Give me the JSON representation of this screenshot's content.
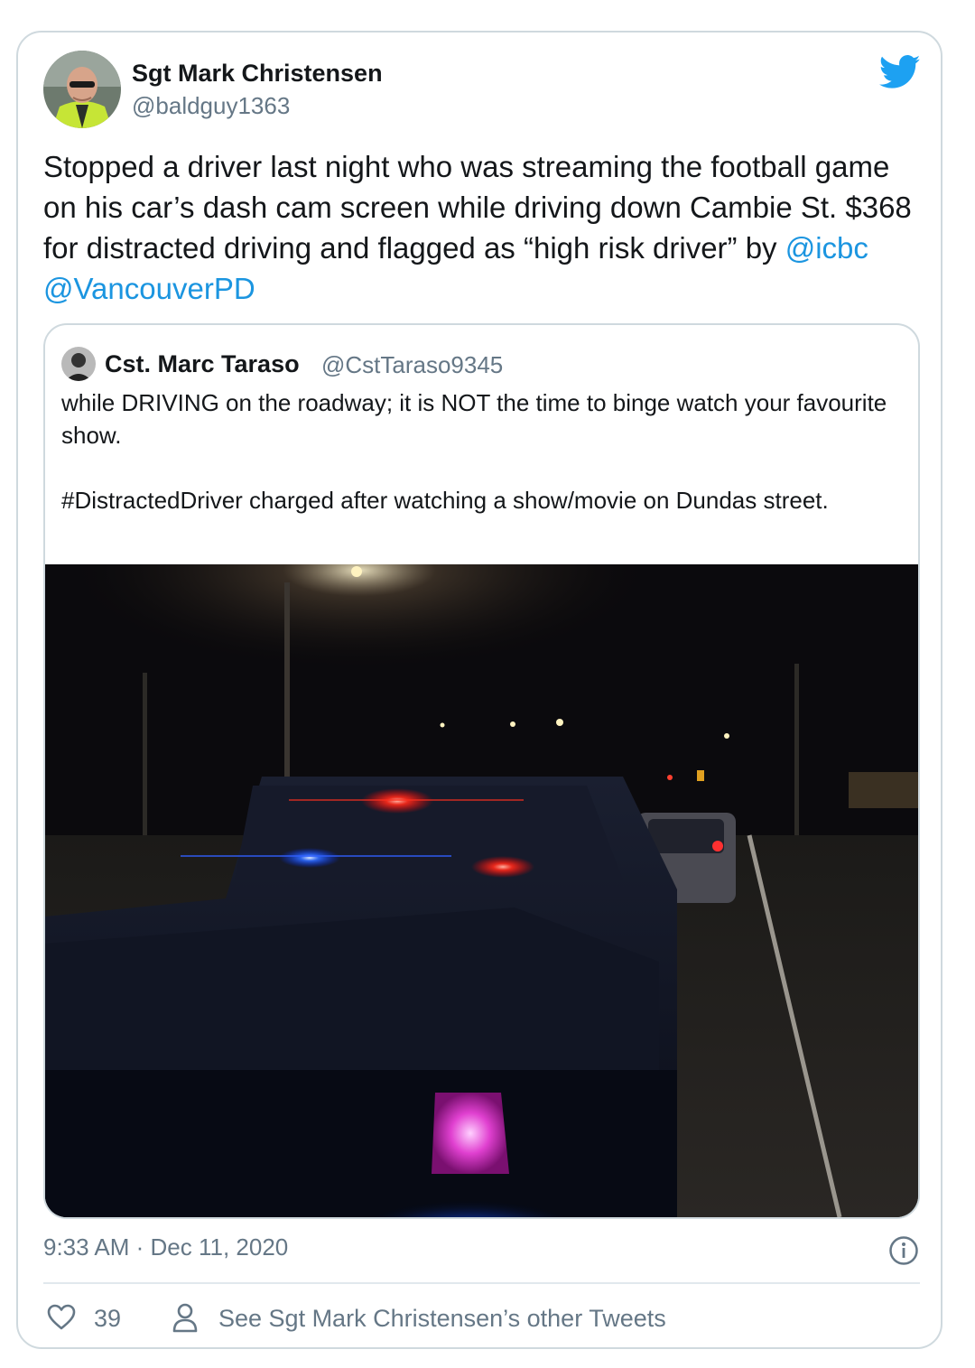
{
  "tweet": {
    "author": {
      "name": "Sgt Mark Christensen",
      "handle": "@baldguy1363"
    },
    "text_main": "Stopped a driver last night who was streaming the football game on his car’s dash cam screen while driving down Cambie St. $368 for distracted driving and flagged as “high risk driver” by ",
    "mentions": [
      "@icbc",
      "@VancouverPD"
    ],
    "timestamp": "9:33 AM · Dec 11, 2020",
    "likes": "39",
    "see_other_tweets": "See Sgt Mark Christensen’s other Tweets"
  },
  "quoted": {
    "name": "Cst. Marc Taraso",
    "handle": "@CstTaraso9345",
    "text_line1": "while DRIVING on the roadway; it is NOT the time to binge watch your favourite show.",
    "text_line2": "#DistractedDriver charged after watching a show/movie on Dundas street."
  },
  "icons": {
    "brand": "twitter-bird-icon",
    "info": "info-icon",
    "like": "heart-icon",
    "profile": "person-icon"
  },
  "colors": {
    "brand_blue": "#1da1f2",
    "link_blue": "#1b95e0",
    "text": "#14171a",
    "muted": "#657786",
    "border": "#cfd9de"
  }
}
